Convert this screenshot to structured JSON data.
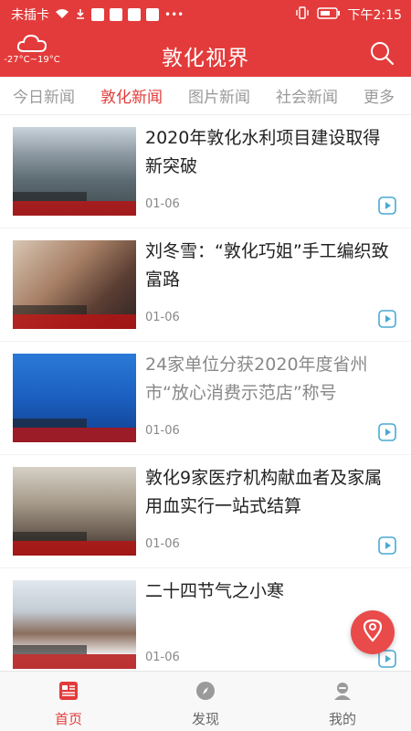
{
  "status_bar": {
    "carrier": "未插卡",
    "time": "下午2:15",
    "icons": [
      "wifi-icon",
      "download-icon",
      "app-badge-icons",
      "more-dots-icon",
      "vibrate-icon",
      "battery-icon"
    ]
  },
  "header": {
    "title": "敦化视界",
    "weather": "-27°C~19°C",
    "weather_icon": "cloud-icon",
    "search_icon": "search-icon"
  },
  "tabs": [
    {
      "label": "今日新闻",
      "active": false
    },
    {
      "label": "敦化新闻",
      "active": true
    },
    {
      "label": "图片新闻",
      "active": false
    },
    {
      "label": "社会新闻",
      "active": false
    },
    {
      "label": "更多",
      "active": false
    }
  ],
  "news": [
    {
      "title": "2020年敦化水利项目建设取得新突破",
      "date": "01-06",
      "read": false
    },
    {
      "title": "刘冬雪：“敦化巧姐”手工编织致富路",
      "date": "01-06",
      "read": false
    },
    {
      "title": "24家单位分获2020年度省州市“放心消费示范店”称号",
      "date": "01-06",
      "read": true
    },
    {
      "title": "敦化9家医疗机构献血者及家属用血实行一站式结算",
      "date": "01-06",
      "read": false
    },
    {
      "title": "二十四节气之小寒",
      "date": "01-06",
      "read": false
    }
  ],
  "bottom_nav": [
    {
      "label": "首页",
      "icon": "news-icon",
      "active": true
    },
    {
      "label": "发现",
      "icon": "compass-icon",
      "active": false
    },
    {
      "label": "我的",
      "icon": "user-icon",
      "active": false
    }
  ],
  "colors": {
    "accent": "#e33b3b",
    "read_text": "#888888"
  }
}
